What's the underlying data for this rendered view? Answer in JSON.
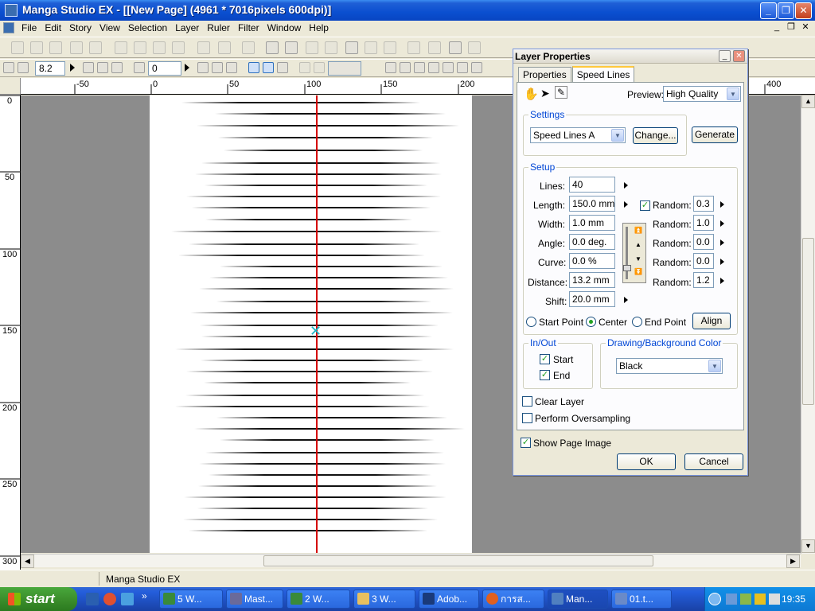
{
  "window": {
    "title": "Manga Studio EX - [[New Page] (4961 * 7016pixels 600dpi)]",
    "buttons": {
      "minimize": "_",
      "maximize": "❐",
      "close": "✕"
    }
  },
  "menu": {
    "items": [
      "File",
      "Edit",
      "Story",
      "View",
      "Selection",
      "Layer",
      "Ruler",
      "Filter",
      "Window",
      "Help"
    ],
    "mdi_buttons": [
      "_",
      "❐",
      "✕"
    ]
  },
  "toolbar2": {
    "zoom": "8.2",
    "angle": "0"
  },
  "rulers": {
    "top_labels": [
      "-50",
      "0",
      "50",
      "100",
      "150",
      "200",
      "400"
    ],
    "left_labels": [
      "0",
      "50",
      "100",
      "150",
      "200",
      "250",
      "300"
    ]
  },
  "status": {
    "text": "Manga Studio EX"
  },
  "taskbar": {
    "start": "start",
    "tasks": [
      {
        "label": "5 W...",
        "color": "#3a8a3a"
      },
      {
        "label": "Mast...",
        "color": "#6a6a9a"
      },
      {
        "label": "2 W...",
        "color": "#3a8a3a"
      },
      {
        "label": "3 W...",
        "color": "#e8c060"
      },
      {
        "label": "Adob...",
        "color": "#1a3a7a"
      },
      {
        "label": "การส...",
        "color": "#e06020"
      },
      {
        "label": "Man...",
        "color": "#5080c0"
      },
      {
        "label": "01.t...",
        "color": "#6a8ac8"
      }
    ],
    "clock": "19:35"
  },
  "dialog": {
    "title": "Layer Properties",
    "tabs": [
      "Properties",
      "Speed Lines"
    ],
    "preview_label": "Preview:",
    "preview_value": "High Quality",
    "settings": {
      "group": "Settings",
      "pattern": "Speed Lines A",
      "change": "Change...",
      "generate": "Generate"
    },
    "setup": {
      "group": "Setup",
      "rows": [
        {
          "label": "Lines:",
          "value": "40"
        },
        {
          "label": "Length:",
          "value": "150.0 mm",
          "random": "0.3",
          "random_checked": true
        },
        {
          "label": "Width:",
          "value": "1.0 mm",
          "random": "1.0"
        },
        {
          "label": "Angle:",
          "value": "0.0 deg.",
          "random": "0.0"
        },
        {
          "label": "Curve:",
          "value": "0.0 %",
          "random": "0.0"
        },
        {
          "label": "Distance:",
          "value": "13.2 mm",
          "random": "1.2"
        },
        {
          "label": "Shift:",
          "value": "20.0 mm"
        }
      ],
      "random_label": "Random:",
      "start_point": "Start Point",
      "center": "Center",
      "end_point": "End Point",
      "align": "Align"
    },
    "inout": {
      "group": "In/Out",
      "start": "Start",
      "end": "End"
    },
    "color": {
      "group": "Drawing/Background Color",
      "value": "Black"
    },
    "clear_layer": "Clear Layer",
    "oversampling": "Perform Oversampling",
    "show_page_image": "Show Page Image",
    "ok": "OK",
    "cancel": "Cancel"
  }
}
